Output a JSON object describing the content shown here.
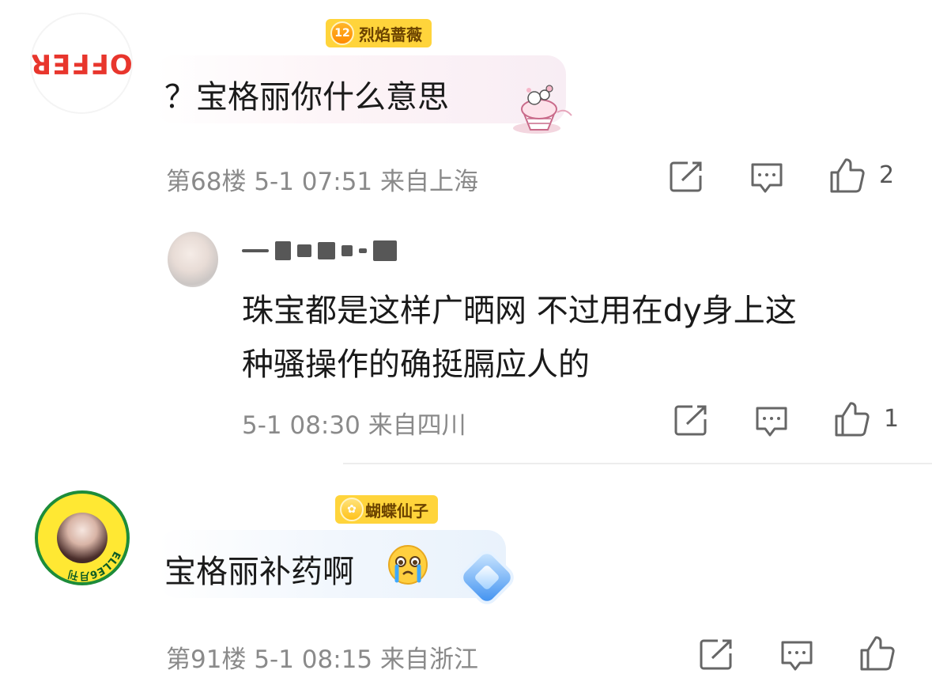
{
  "comments": [
    {
      "avatar_text": "OFFER",
      "badge_level": "12",
      "badge_label": "烈焰蔷薇",
      "text": "？宝格丽你什么意思",
      "floor": "第68楼",
      "time": "5-1 07:51",
      "location": "来自上海",
      "likes": "2"
    },
    {
      "avatar_text": "ELLE6月刊",
      "badge_label": "蝴蝶仙子",
      "text": "宝格丽补药啊",
      "floor": "第91楼",
      "time": "5-1 08:15",
      "location": "来自浙江",
      "likes": ""
    }
  ],
  "reply": {
    "line1": "珠宝都是这样广晒网  不过用在dy身上这",
    "line2": "种骚操作的确挺膈应人的",
    "time": "5-1 08:30",
    "location": "来自四川",
    "likes": "1"
  },
  "icons": {
    "share": "share-icon",
    "comment": "comment-icon",
    "like": "thumbs-up-icon"
  },
  "colors": {
    "badge": "#ffd43b",
    "meta_text": "#8a8a8a",
    "offer_red": "#e8362d"
  }
}
